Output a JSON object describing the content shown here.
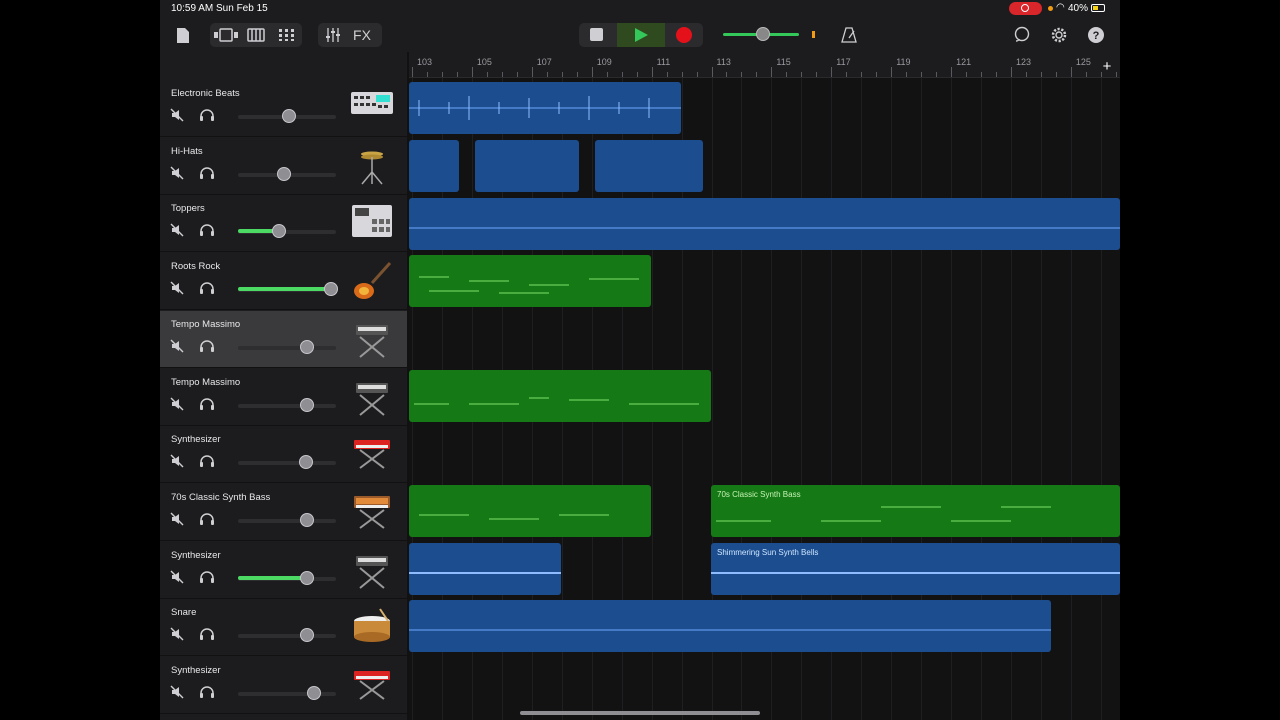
{
  "status_bar": {
    "time": "10:59 AM",
    "date": "Sun Feb 15",
    "battery": "40%"
  },
  "toolbar": {
    "fx_label": "FX"
  },
  "ruler": {
    "labels": [
      "103",
      "105",
      "107",
      "109",
      "111",
      "113",
      "115",
      "117",
      "119",
      "121",
      "123",
      "125"
    ],
    "add_label": "+"
  },
  "tracks": [
    {
      "name": "Electronic Beats",
      "volume": 0.52,
      "icon": "drum-machine-icon"
    },
    {
      "name": "Hi-Hats",
      "volume": 0.47,
      "icon": "hi-hat-icon"
    },
    {
      "name": "Toppers",
      "volume": 0.42,
      "active": true,
      "icon": "sampler-icon"
    },
    {
      "name": "Roots Rock",
      "volume": 0.95,
      "active": true,
      "icon": "electric-guitar-icon"
    },
    {
      "name": "Tempo Massimo",
      "volume": 0.7,
      "selected": true,
      "icon": "keyboard-stand-icon"
    },
    {
      "name": "Tempo Massimo",
      "volume": 0.7,
      "icon": "keyboard-stand-icon"
    },
    {
      "name": "Synthesizer",
      "volume": 0.69,
      "icon": "red-synth-icon"
    },
    {
      "name": "70s Classic Synth Bass",
      "volume": 0.7,
      "icon": "analog-synth-icon"
    },
    {
      "name": "Synthesizer",
      "volume": 0.7,
      "active": true,
      "icon": "keyboard-stand-icon"
    },
    {
      "name": "Snare",
      "volume": 0.7,
      "icon": "snare-drum-icon"
    },
    {
      "name": "Synthesizer",
      "volume": 0.78,
      "icon": "red-synth-icon"
    }
  ],
  "regions": {
    "r1": "",
    "r8b": "70s Classic Synth Bass",
    "r9b": "Shimmering Sun Synth Bells"
  },
  "colors": {
    "audio_region": "#1b4d8f",
    "midi_region": "#157a15",
    "accent_green": "#34c759",
    "record_red": "#e5111a"
  }
}
